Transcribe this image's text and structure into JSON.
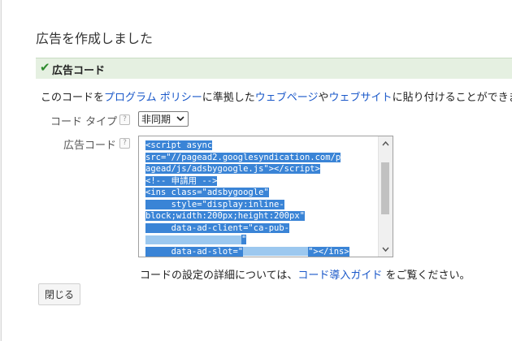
{
  "dialog": {
    "title": "広告を作成しました",
    "section_title": "広告コード",
    "description": {
      "part1": "このコードを",
      "link1": "プログラム ポリシー",
      "part2": "に準拠した",
      "link2": "ウェブページ",
      "part3": "や",
      "link3": "ウェブサイト",
      "part4": "に貼り付けることができま"
    },
    "code_type_label": "コード タイプ",
    "code_type_value": "非同期",
    "ad_code_label": "広告コード",
    "help_glyph": "?",
    "code_lines": [
      "<script async",
      "src=\"//pagead2.googlesyndication.com/p",
      "agead/js/adsbygoogle.js\"></scr",
      "<!-- 申請用 -->",
      "<ins class=\"adsbygoogle\"",
      "     style=\"display:inline-",
      "block;width:200px;height:200px\"",
      "     data-ad-client=\"ca-pub-",
      "\"",
      "     data-ad-slot=\"",
      "\"></ins>"
    ],
    "hint": {
      "part1": "コードの設定の詳細については、",
      "link": "コード導入ガイド",
      "part2": " をご覧ください。"
    },
    "close_label": "閉じる"
  }
}
